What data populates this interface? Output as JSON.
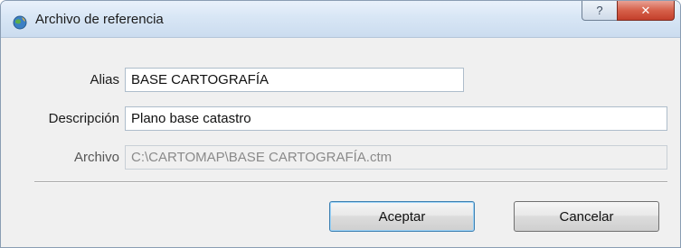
{
  "window": {
    "title": "Archivo de referencia",
    "help_glyph": "?",
    "close_glyph": "✕",
    "app_icon": "globe-app-icon"
  },
  "form": {
    "alias": {
      "label": "Alias",
      "value": "BASE CARTOGRAFÍA"
    },
    "descripcion": {
      "label": "Descripción",
      "value": "Plano base catastro"
    },
    "archivo": {
      "label": "Archivo",
      "value": "C:\\CARTOMAP\\BASE CARTOGRAFÍA.ctm"
    }
  },
  "buttons": {
    "accept_label": "Aceptar",
    "cancel_label": "Cancelar"
  },
  "colors": {
    "titlebar": "#d8e6f5",
    "close_button": "#d6604a",
    "dialog_background": "#f0f0f0"
  }
}
